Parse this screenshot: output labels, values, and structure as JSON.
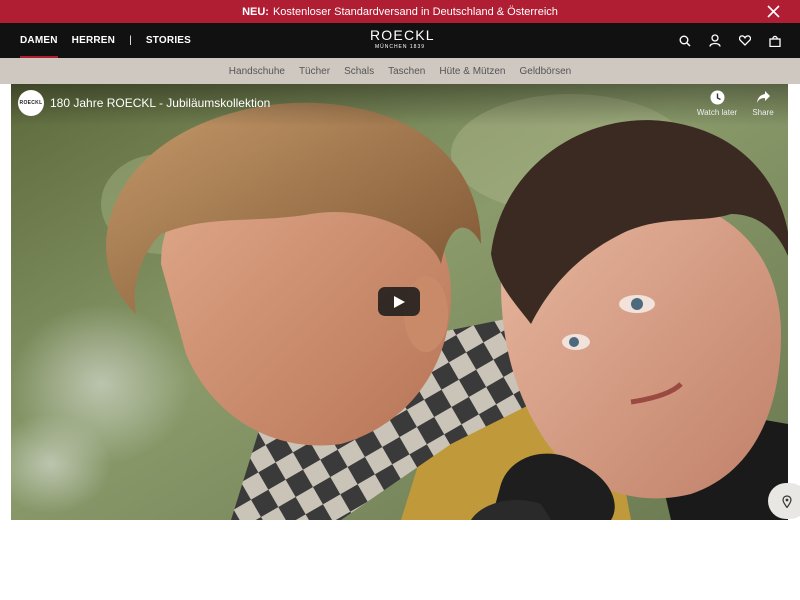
{
  "promo": {
    "label": "NEU:",
    "text": "Kostenloser Standardversand in Deutschland & Österreich"
  },
  "nav": {
    "items": [
      {
        "label": "DAMEN",
        "active": true
      },
      {
        "label": "HERREN",
        "active": false
      },
      {
        "label": "|",
        "active": false
      },
      {
        "label": "STORIES",
        "active": false
      }
    ],
    "logo_brand": "ROECKL",
    "logo_city": "MÜNCHEN 1839",
    "icons": [
      "search-icon",
      "account-icon",
      "heart-icon",
      "bag-icon"
    ]
  },
  "categories": [
    "Handschuhe",
    "Tücher",
    "Schals",
    "Taschen",
    "Hüte & Mützen",
    "Geldbörsen"
  ],
  "video": {
    "channel": "ROECKL",
    "title": "180 Jahre ROECKL - Jubiläumskollektion",
    "watch_later": "Watch later",
    "share": "Share"
  },
  "colors": {
    "promo_bg": "#b01e34",
    "nav_bg": "#111111",
    "cats_bg": "#cfc8c1"
  }
}
